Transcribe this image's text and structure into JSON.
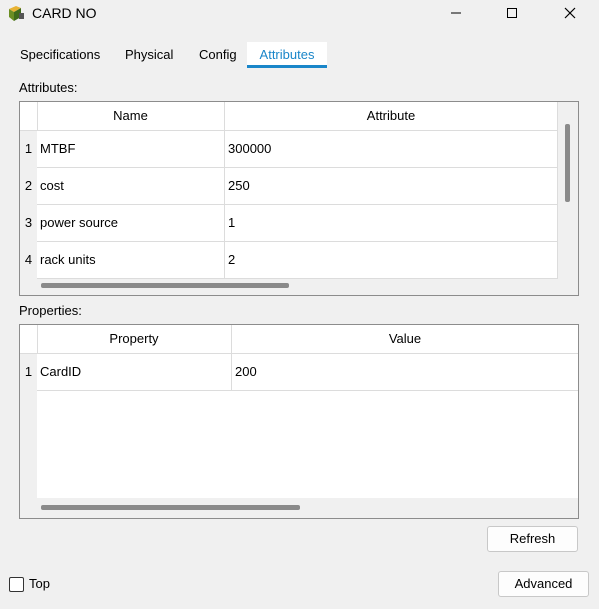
{
  "window": {
    "title": "CARD NO"
  },
  "tabs": [
    {
      "label": "Specifications"
    },
    {
      "label": "Physical"
    },
    {
      "label": "Config"
    },
    {
      "label": "Attributes"
    }
  ],
  "attributes": {
    "section_label": "Attributes:",
    "columns": [
      "Name",
      "Attribute"
    ],
    "rows": [
      {
        "num": "1",
        "name": "MTBF",
        "value": "300000"
      },
      {
        "num": "2",
        "name": "cost",
        "value": "250"
      },
      {
        "num": "3",
        "name": "power source",
        "value": "1"
      },
      {
        "num": "4",
        "name": "rack units",
        "value": "2"
      }
    ]
  },
  "properties": {
    "section_label": "Properties:",
    "columns": [
      "Property",
      "Value"
    ],
    "rows": [
      {
        "num": "1",
        "name": "CardID",
        "value": "200"
      }
    ]
  },
  "buttons": {
    "refresh": "Refresh",
    "advanced": "Advanced"
  },
  "footer": {
    "top_label": "Top"
  },
  "colors": {
    "accent": "#1a86c9",
    "background": "#f0f0f0"
  }
}
